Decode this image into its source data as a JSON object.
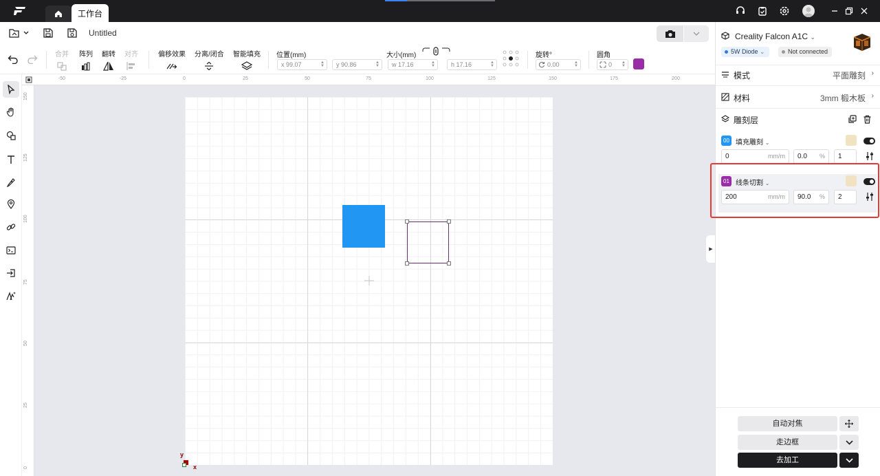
{
  "titlebar": {
    "tab_work_label": "工作台"
  },
  "file": {
    "name": "Untitled"
  },
  "toolbar": {
    "combine": "合并",
    "array": "阵列",
    "flip": "翻转",
    "align": "对齐",
    "offset": "偏移效果",
    "split_close": "分离/闭合",
    "smart_fill": "智能填充",
    "position_label": "位置(mm)",
    "pos_x": "x 99.07",
    "pos_y": "y 90.86",
    "size_label": "大小(mm)",
    "size_w": "w 17.16",
    "size_h": "h 17.16",
    "rotate_label": "旋转°",
    "rotate_value": "0.00",
    "corner_label": "圆角",
    "corner_value": "0",
    "layer_color": "#9a2ca8"
  },
  "ruler": {
    "top_ticks": [
      "-50",
      "-25",
      "0",
      "25",
      "50",
      "75",
      "100",
      "125",
      "150",
      "175",
      "200"
    ],
    "left_ticks": [
      "150",
      "125",
      "100",
      "75",
      "50",
      "25",
      "0"
    ]
  },
  "canvas": {
    "axis_x": "x",
    "axis_y": "y",
    "fill_color": "#2196f3",
    "outline_color": "#6a2c6e"
  },
  "device": {
    "name": "Creality Falcon A1C",
    "laser_badge": "5W Diode",
    "status_badge": "Not connected"
  },
  "settings": {
    "mode_label": "模式",
    "mode_value": "平面雕刻",
    "material_label": "材料",
    "material_value": "3mm 椴木板",
    "layers_label": "雕刻层"
  },
  "layers": [
    {
      "tag": "00",
      "name": "填充雕刻",
      "speed": "0",
      "speed_unit": "mm/m",
      "power": "0.0",
      "power_unit": "%",
      "passes": "1",
      "tag_color": "#2196f3"
    },
    {
      "tag": "01",
      "name": "线条切割",
      "speed": "200",
      "speed_unit": "mm/m",
      "power": "90.0",
      "power_unit": "%",
      "passes": "2",
      "tag_color": "#9a2ca8"
    }
  ],
  "actions": {
    "autofocus": "自动对焦",
    "frame": "走边框",
    "start": "去加工"
  }
}
